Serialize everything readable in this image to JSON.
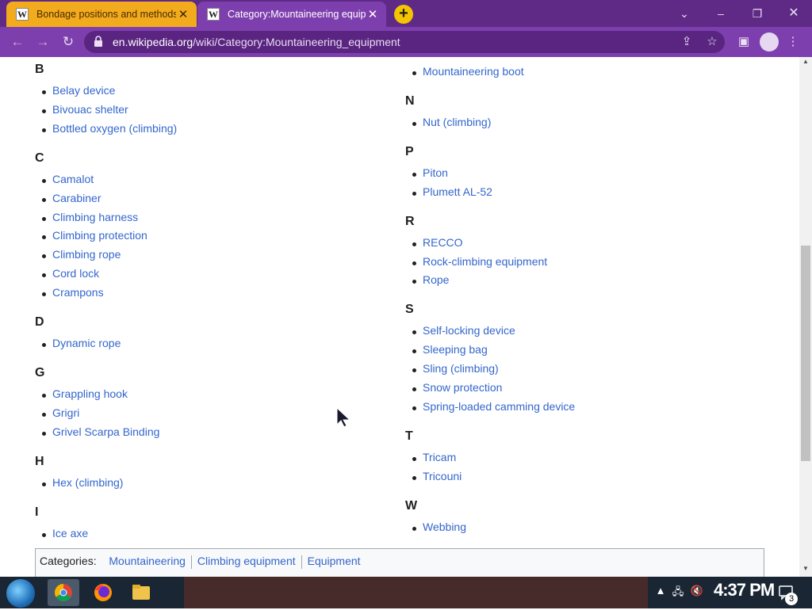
{
  "browser": {
    "tabs": [
      {
        "title": "Bondage positions and methods",
        "favicon": "W"
      },
      {
        "title": "Category:Mountaineering equipment",
        "favicon": "W"
      }
    ],
    "new_tab_icon": "+",
    "url_domain": "en.wikipedia.org",
    "url_path": "/wiki/Category:Mountaineering_equipment",
    "theme_colors": {
      "frame": "#5f2a86",
      "toolbar": "#7e3fae",
      "active_tab_inactive": "#f3ab1e"
    }
  },
  "left_column": [
    {
      "letter": "B",
      "items": [
        "Belay device",
        "Bivouac shelter",
        "Bottled oxygen (climbing)"
      ]
    },
    {
      "letter": "C",
      "items": [
        "Camalot",
        "Carabiner",
        "Climbing harness",
        "Climbing protection",
        "Climbing rope",
        "Cord lock",
        "Crampons"
      ]
    },
    {
      "letter": "D",
      "items": [
        "Dynamic rope"
      ]
    },
    {
      "letter": "G",
      "items": [
        "Grappling hook",
        "Grigri",
        "Grivel Scarpa Binding"
      ]
    },
    {
      "letter": "H",
      "items": [
        "Hex (climbing)"
      ]
    },
    {
      "letter": "I",
      "items": [
        "Ice axe"
      ]
    }
  ],
  "right_column": {
    "continued_items": [
      "Mountaineering boot"
    ],
    "groups": [
      {
        "letter": "N",
        "items": [
          "Nut (climbing)"
        ]
      },
      {
        "letter": "P",
        "items": [
          "Piton",
          "Plumett AL-52"
        ]
      },
      {
        "letter": "R",
        "items": [
          "RECCO",
          "Rock-climbing equipment",
          "Rope"
        ]
      },
      {
        "letter": "S",
        "items": [
          "Self-locking device",
          "Sleeping bag",
          "Sling (climbing)",
          "Snow protection",
          "Spring-loaded camming device"
        ]
      },
      {
        "letter": "T",
        "items": [
          "Tricam",
          "Tricouni"
        ]
      },
      {
        "letter": "W",
        "items": [
          "Webbing"
        ]
      }
    ]
  },
  "categories": {
    "label": "Categories:",
    "links": [
      "Mountaineering",
      "Climbing equipment",
      "Equipment"
    ]
  },
  "taskbar": {
    "clock": "4:37 PM",
    "notification_count": "3"
  }
}
